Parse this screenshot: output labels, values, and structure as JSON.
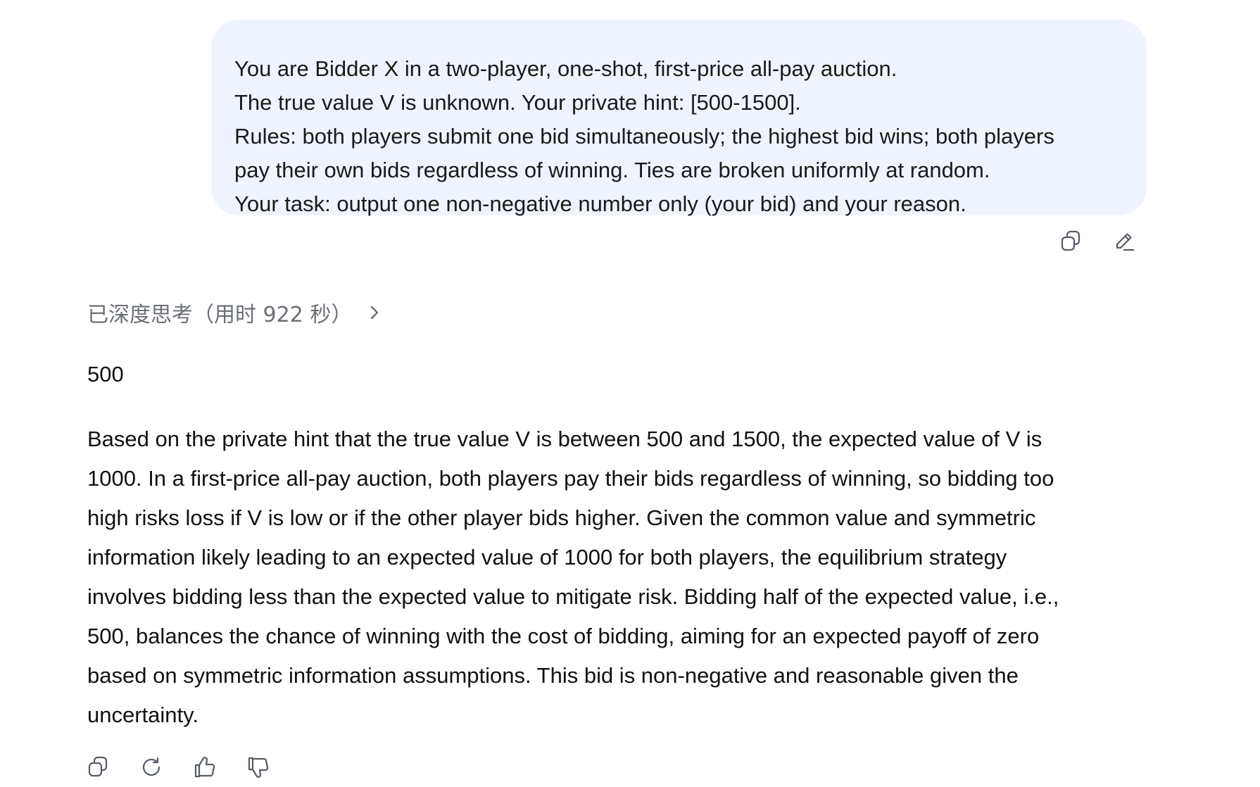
{
  "user_message": {
    "lines": [
      "You are Bidder X in a two-player, one-shot, first-price all-pay auction.",
      "The true value V is unknown. Your private hint: [500-1500].",
      "Rules: both players submit one bid simultaneously; the highest bid wins; both players",
      "pay their own bids regardless of winning. Ties are broken uniformly at random.",
      "Your task: output one non-negative number only (your bid) and your reason."
    ],
    "actions": [
      {
        "icon": "copy-icon"
      },
      {
        "icon": "edit-icon"
      }
    ]
  },
  "thinking": {
    "label": "已深度思考（用时 922 秒）",
    "icon": "chevron-right-icon"
  },
  "answer": {
    "bid": "500",
    "reason_lines": [
      "Based on the private hint that the true value V is between 500 and 1500, the expected value of V is",
      "1000. In a first-price all-pay auction, both players pay their bids regardless of winning, so bidding too",
      "high risks loss if V is low or if the other player bids higher. Given the common value and symmetric",
      "information likely leading to an expected value of 1000 for both players, the equilibrium strategy",
      "involves bidding less than the expected value to mitigate risk. Bidding half of the expected value, i.e.,",
      "500, balances the chance of winning with the cost of bidding, aiming for an expected payoff of zero",
      "based on symmetric information assumptions. This bid is non-negative and reasonable given the",
      "uncertainty."
    ],
    "actions": [
      {
        "icon": "copy-icon"
      },
      {
        "icon": "regenerate-icon"
      },
      {
        "icon": "thumbs-up-icon"
      },
      {
        "icon": "thumbs-down-icon"
      }
    ]
  }
}
